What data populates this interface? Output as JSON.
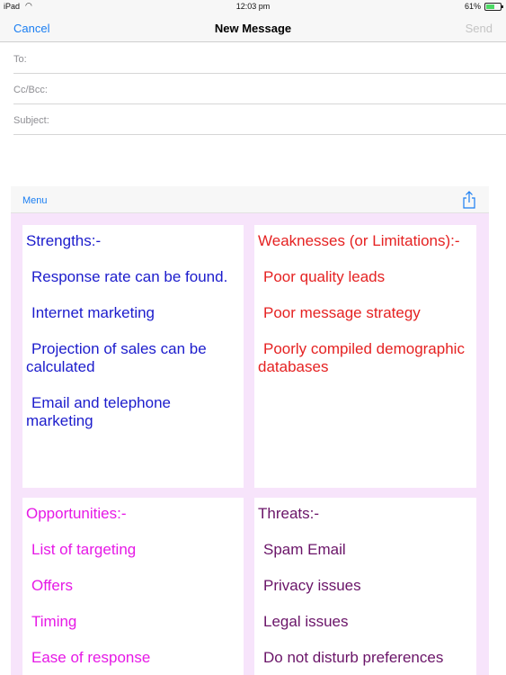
{
  "status_bar": {
    "device": "iPad",
    "time": "12:03 pm",
    "battery": "61%",
    "battery_level": 0.61
  },
  "nav": {
    "cancel_label": "Cancel",
    "title": "New Message",
    "send_label": "Send"
  },
  "fields": {
    "to_label": "To:",
    "cc_label": "Cc/Bcc:",
    "subject_label": "Subject:"
  },
  "panel": {
    "menu_label": "Menu",
    "share_icon": "share-icon"
  },
  "swot": {
    "strengths": {
      "heading": "Strengths:-",
      "items": [
        "Response rate can be found.",
        "Internet marketing",
        "Projection of sales can be calculated",
        "Email and telephone marketing"
      ]
    },
    "weaknesses": {
      "heading": "Weaknesses (or Limitations):-",
      "items": [
        "Poor quality leads",
        "Poor message strategy",
        "Poorly compiled demographic databases"
      ]
    },
    "opportunities": {
      "heading": "Opportunities:-",
      "items": [
        "List of targeting",
        "Offers",
        "Timing",
        "Ease of response"
      ]
    },
    "threats": {
      "heading": "Threats:-",
      "items": [
        "Spam Email",
        "Privacy issues",
        "Legal issues",
        "Do not disturb preferences"
      ]
    }
  },
  "colors": {
    "strengths": "#1c1ccc",
    "weaknesses": "#e52222",
    "opportunities": "#e619e6",
    "threats": "#6a1468",
    "panel_background": "#f7e4fb",
    "accent": "#1a7ef2"
  }
}
